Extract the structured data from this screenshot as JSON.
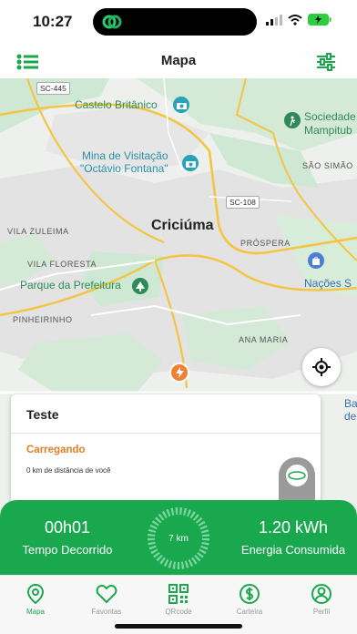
{
  "status_bar": {
    "time": "10:27"
  },
  "header": {
    "title": "Mapa",
    "list_icon": "list-icon",
    "filter_icon": "sliders-icon"
  },
  "map": {
    "roads": {
      "sc445": "SC-445",
      "sc108": "SC-108"
    },
    "labels": {
      "castelo": "Castelo Britânico",
      "sociedade": "Sociedade",
      "mampituba": "Mampitub",
      "mina_line1": "Mina de Visitação",
      "mina_line2": "\"Octávio Fontana\"",
      "sao_simao": "SÃO SIMÃO",
      "vila_zuleima": "VILA ZULEIMA",
      "criciuma": "Criciúma",
      "prospera": "PRÓSPERA",
      "vila_floresta": "VILA FLORESTA",
      "nacoes": "Nações S",
      "parque": "Parque da Prefeitura",
      "pinheirinho": "PINHEIRINHO",
      "ana_maria": "ANA MARIA",
      "ba": "Ba",
      "de": "de"
    },
    "colors": {
      "land": "#eef0ee",
      "park": "#cfe8d3",
      "urban": "#e1e1e1",
      "major_road": "#f4c542"
    }
  },
  "station_card": {
    "title": "Teste",
    "status": "Carregando",
    "distance": "0 km de distância de você"
  },
  "progress_panel": {
    "elapsed_value": "00h01",
    "elapsed_label": "Tempo Decorrido",
    "range_label": "7 km",
    "energy_value": "1.20 kWh",
    "energy_label": "Energia Consumida",
    "accent": "#1aa84f"
  },
  "tabbar": {
    "tabs": [
      {
        "label": "Mapa",
        "icon": "map-pin-icon",
        "active": true
      },
      {
        "label": "Favoritas",
        "icon": "heart-icon",
        "active": false
      },
      {
        "label": "QRcode",
        "icon": "qrcode-icon",
        "active": false
      },
      {
        "label": "Carteira",
        "icon": "dollar-icon",
        "active": false
      },
      {
        "label": "Perfil",
        "icon": "user-icon",
        "active": false
      }
    ]
  }
}
